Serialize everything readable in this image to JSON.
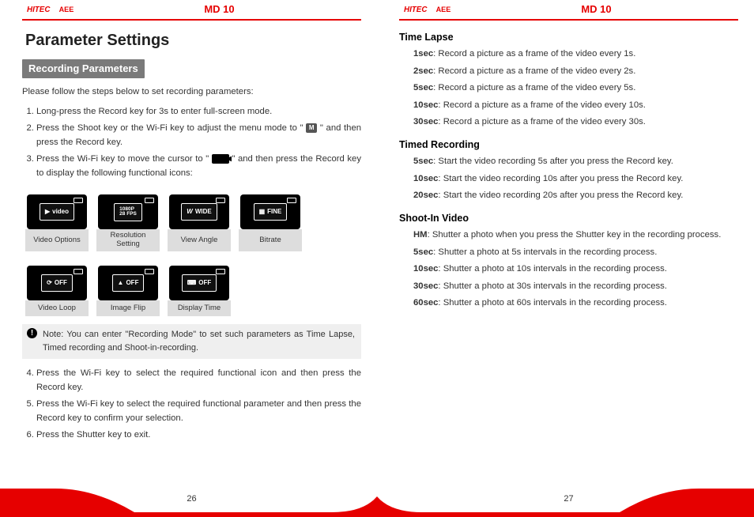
{
  "header": {
    "product": "MD 10"
  },
  "left": {
    "title": "Parameter Settings",
    "section": "Recording Parameters",
    "intro": "Please follow the steps below to set recording parameters:",
    "step1": "Long-press the Record key for 3s to enter full-screen mode.",
    "step2a": "Press the Shoot key or the Wi-Fi key to adjust the menu mode to \" ",
    "step2_chip": "M",
    "step2b": " \" and then press the Record key.",
    "step3a": "Press the Wi-Fi key to move the cursor to \" ",
    "step3b": " \" and then press the Record key to display the following functional icons:",
    "row1": {
      "icon1": "video",
      "label1": "Video Options",
      "icon2": "1080P\n28 FPS",
      "label2": "Resolution Setting",
      "icon3": "WIDE",
      "label3": "View Angle",
      "icon4": "FINE",
      "label4": "Bitrate"
    },
    "row2": {
      "icon1": "OFF",
      "label1": "Video Loop",
      "icon2": "OFF",
      "label2": "Image Flip",
      "icon3": "OFF",
      "label3": "Display Time"
    },
    "note": "Note: You can enter \"Recording Mode\" to set such parameters as Time Lapse, Timed recording and Shoot-in-recording.",
    "step4": "Press the Wi-Fi key to select the required functional icon and then press the Record key.",
    "step5": "Press the Wi-Fi key to select the required functional parameter and then press the Record key to confirm your selection.",
    "step6": "Press the Shutter key to exit.",
    "page": "26"
  },
  "right": {
    "tl_title": "Time Lapse",
    "tl_1b": "1sec",
    "tl_1": ": Record a picture as a frame of the video every 1s.",
    "tl_2b": "2sec",
    "tl_2": ": Record a picture as a frame of the video every 2s.",
    "tl_5b": "5sec",
    "tl_5": ": Record a picture as a frame of the video every 5s.",
    "tl_10b": "10sec",
    "tl_10": ": Record a picture as a frame of the video every 10s.",
    "tl_30b": "30sec",
    "tl_30": ": Record a picture as a frame of the video every 30s.",
    "tr_title": "Timed Recording",
    "tr_5b": "5sec",
    "tr_5": ": Start the video recording 5s after you press the Record key.",
    "tr_10b": "10sec",
    "tr_10": ": Start the video recording 10s after you press the Record key.",
    "tr_20b": "20sec",
    "tr_20": ": Start the video recording 20s after you press the Record key.",
    "si_title": "Shoot-In Video",
    "si_hmb": "HM",
    "si_hm": ": Shutter a photo when you press the Shutter key in the recording process.",
    "si_5b": "5sec",
    "si_5": ": Shutter a photo at 5s intervals in the recording process.",
    "si_10b": "10sec",
    "si_10": ": Shutter a photo at 10s intervals in the recording process.",
    "si_30b": "30sec",
    "si_30": ": Shutter a photo at 30s intervals in the recording process.",
    "si_60b": "60sec",
    "si_60": ": Shutter a photo at 60s intervals in the recording process.",
    "page": "27"
  }
}
